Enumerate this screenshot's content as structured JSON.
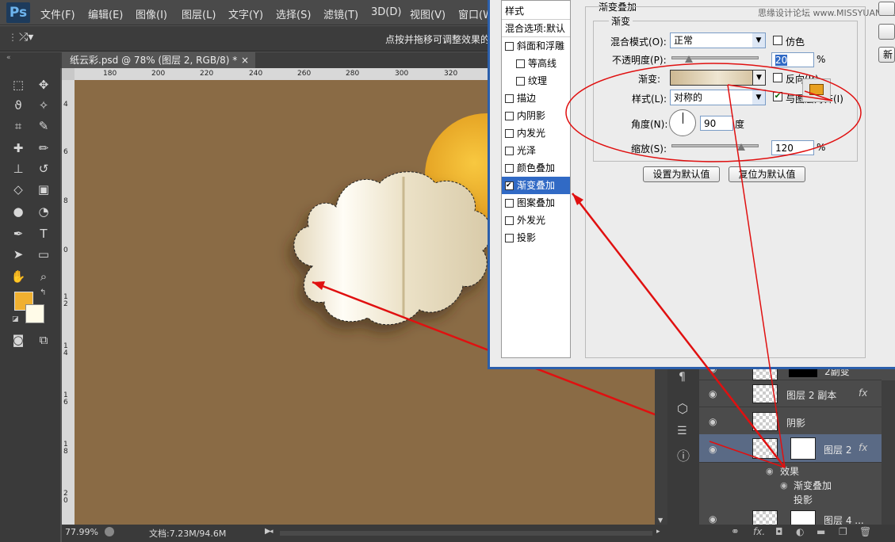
{
  "app": {
    "logo": "Ps"
  },
  "menu": [
    "文件(F)",
    "编辑(E)",
    "图像(I)",
    "图层(L)",
    "文字(Y)",
    "选择(S)",
    "滤镜(T)",
    "3D(D)",
    "视图(V)",
    "窗口(W)"
  ],
  "options_bar": {
    "hint": "点按并拖移可调整效果的"
  },
  "document": {
    "tab_title": "纸云彩.psd @ 78% (图层 2, RGB/8) *",
    "close_symbol": "×",
    "ruler_top": [
      "180",
      "200",
      "220",
      "240",
      "260",
      "280",
      "300",
      "320"
    ],
    "ruler_left": [
      "4",
      "6",
      "8",
      "0",
      "1 2",
      "1 4",
      "1 6",
      "1 8",
      "2 0"
    ]
  },
  "status": {
    "zoom": "77.99%",
    "doc_info": "文档:7.23M/94.6M"
  },
  "colors": {
    "foreground": "#f0b030",
    "background": "#fffbe8",
    "canvas": "#8a6b45",
    "accent": "#2b5fab",
    "annotation": "#e01010"
  },
  "dialog": {
    "watermark": "思缘设计论坛 www.MISSYUAN.COM",
    "section_title": "渐变叠加",
    "group_title": "渐变",
    "style_list_header": "样式",
    "blend_options": "混合选项:默认",
    "styles": [
      {
        "label": "斜面和浮雕",
        "checked": false,
        "indent": false,
        "selected": false
      },
      {
        "label": "等高线",
        "checked": false,
        "indent": true,
        "selected": false
      },
      {
        "label": "纹理",
        "checked": false,
        "indent": true,
        "selected": false
      },
      {
        "label": "描边",
        "checked": false,
        "indent": false,
        "selected": false
      },
      {
        "label": "内阴影",
        "checked": false,
        "indent": false,
        "selected": false
      },
      {
        "label": "内发光",
        "checked": false,
        "indent": false,
        "selected": false
      },
      {
        "label": "光泽",
        "checked": false,
        "indent": false,
        "selected": false
      },
      {
        "label": "颜色叠加",
        "checked": false,
        "indent": false,
        "selected": false
      },
      {
        "label": "渐变叠加",
        "checked": true,
        "indent": false,
        "selected": true
      },
      {
        "label": "图案叠加",
        "checked": false,
        "indent": false,
        "selected": false
      },
      {
        "label": "外发光",
        "checked": false,
        "indent": false,
        "selected": false
      },
      {
        "label": "投影",
        "checked": false,
        "indent": false,
        "selected": false
      }
    ],
    "blend_mode_label": "混合模式(O):",
    "blend_mode_value": "正常",
    "dither_label": "仿色",
    "opacity_label": "不透明度(P):",
    "opacity_value": "20",
    "opacity_level": 0.2,
    "opacity_unit": "%",
    "gradient_label": "渐变:",
    "reverse_label": "反向(R)",
    "style_label": "样式(L):",
    "style_value": "对称的",
    "align_label": "与图层对齐(I)",
    "angle_label": "角度(N):",
    "angle_value": "90",
    "angle_unit": "度",
    "scale_label": "缩放(S):",
    "scale_value": "120",
    "scale_level": 0.8,
    "scale_unit": "%",
    "btn_set_default": "设置为默认值",
    "btn_reset_default": "复位为默认值",
    "side_btn_new": "新"
  },
  "layers": [
    {
      "name": "2副变",
      "fx": false,
      "mask": true
    },
    {
      "name": "图层 2 副本",
      "fx": true,
      "mask": false
    },
    {
      "name": "阴影",
      "fx": false,
      "mask": false
    },
    {
      "name": "图层 2",
      "fx": true,
      "mask": true,
      "selected": true
    }
  ],
  "layer_effects": {
    "header": "效果",
    "items": [
      "渐变叠加",
      "投影"
    ]
  },
  "layer_last": "图层 4 ..."
}
